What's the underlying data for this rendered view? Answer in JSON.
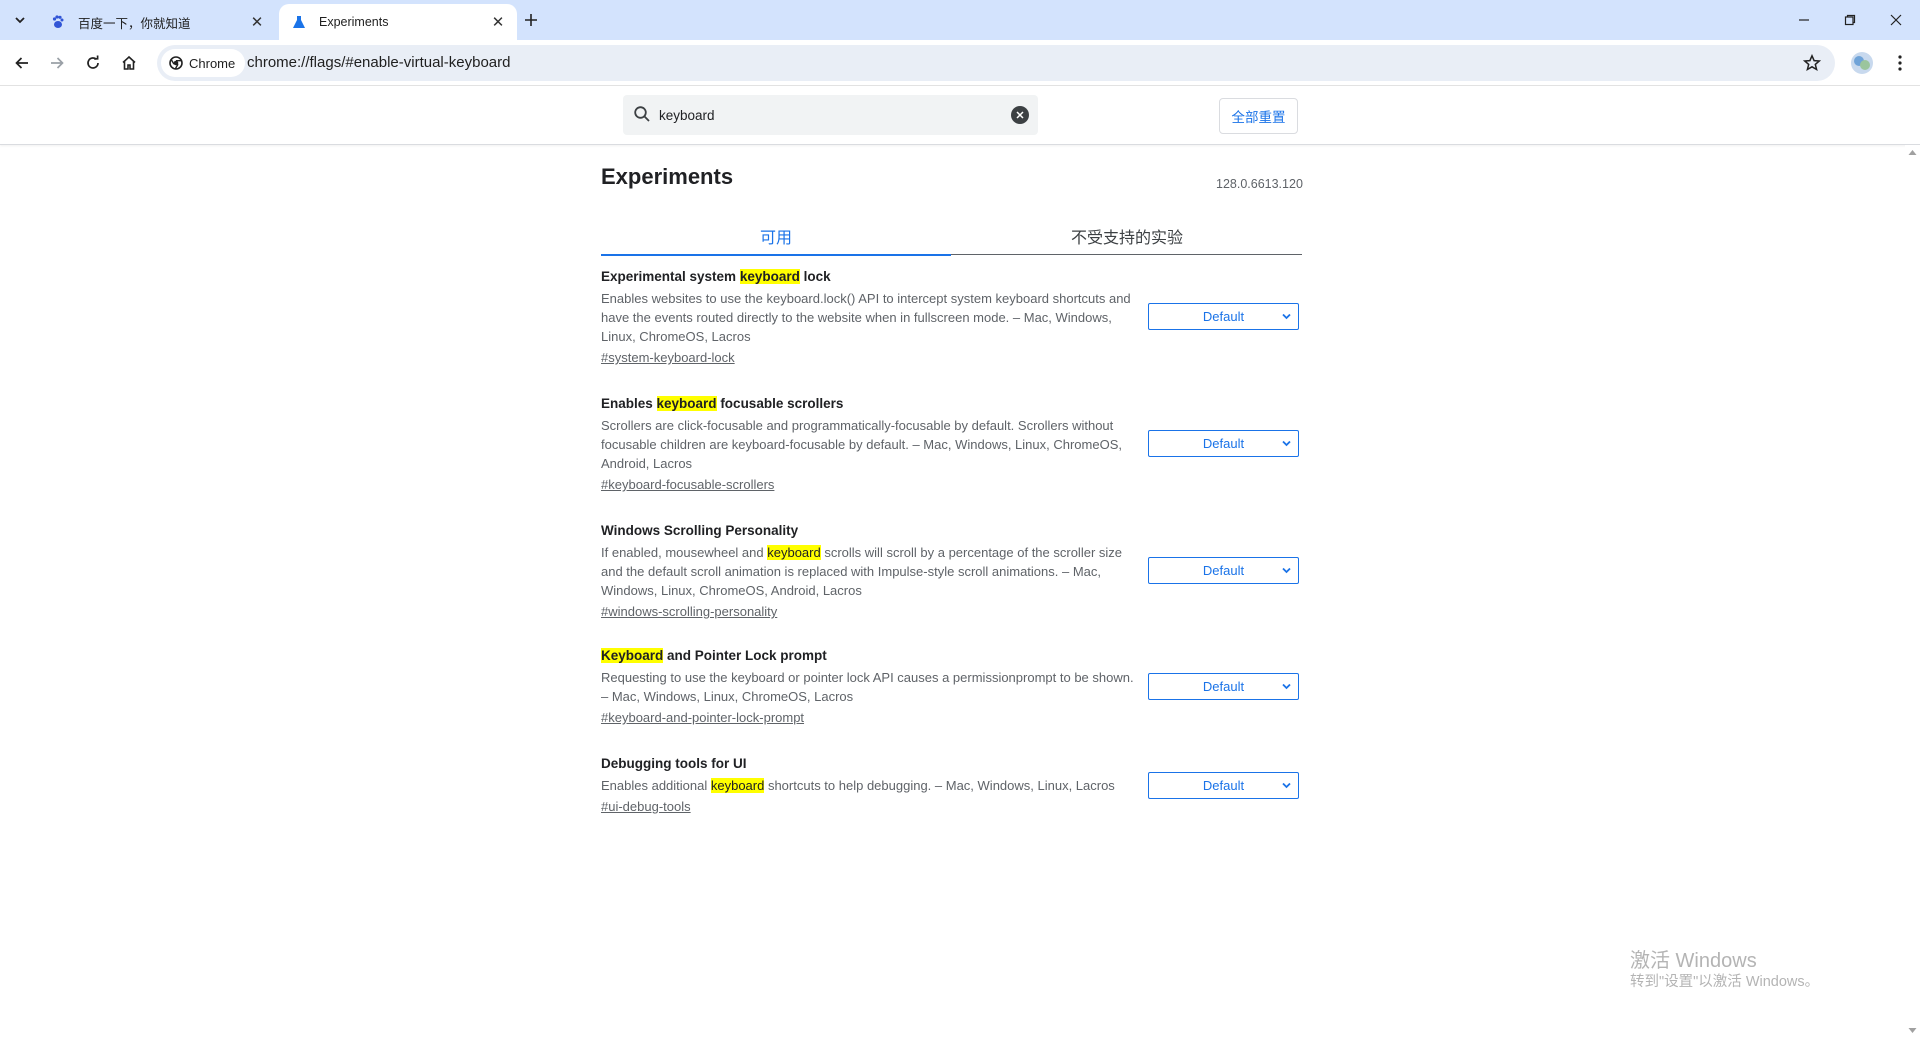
{
  "browser": {
    "tabs": [
      {
        "title": "百度一下，你就知道",
        "favicon": "baidu-paw-icon",
        "active": false
      },
      {
        "title": "Experiments",
        "favicon": "flask-icon",
        "active": true
      }
    ],
    "omnibox": {
      "chip_label": "Chrome",
      "url": "chrome://flags/#enable-virtual-keyboard"
    }
  },
  "flags_header": {
    "search_value": "keyboard",
    "reset_all_label": "全部重置"
  },
  "main": {
    "title": "Experiments",
    "version": "128.0.6613.120",
    "tabs": [
      {
        "label": "可用",
        "selected": true
      },
      {
        "label": "不受支持的实验",
        "selected": false
      }
    ]
  },
  "experiments": [
    {
      "name_pre": "Experimental system ",
      "name_hl": "keyboard",
      "name_post": " lock",
      "desc_pre": "Enables websites to use the keyboard.lock() API to intercept system keyboard shortcuts and have the events routed directly to the website when in fullscreen mode. – Mac, Windows, Linux, ChromeOS, Lacros",
      "desc_hl": "",
      "desc_post": "",
      "link": "#system-keyboard-lock",
      "value": "Default"
    },
    {
      "name_pre": "Enables ",
      "name_hl": "keyboard",
      "name_post": " focusable scrollers",
      "desc_pre": "Scrollers are click-focusable and programmatically-focusable by default. Scrollers without focusable children are keyboard-focusable by default. – Mac, Windows, Linux, ChromeOS, Android, Lacros",
      "desc_hl": "",
      "desc_post": "",
      "link": "#keyboard-focusable-scrollers",
      "value": "Default"
    },
    {
      "name_pre": "Windows Scrolling Personality",
      "name_hl": "",
      "name_post": "",
      "desc_pre": "If enabled, mousewheel and ",
      "desc_hl": "keyboard",
      "desc_post": " scrolls will scroll by a percentage of the scroller size and the default scroll animation is replaced with Impulse-style scroll animations. – Mac, Windows, Linux, ChromeOS, Android, Lacros",
      "link": "#windows-scrolling-personality",
      "value": "Default"
    },
    {
      "name_pre": "",
      "name_hl": "Keyboard",
      "name_post": " and Pointer Lock prompt",
      "desc_pre": "Requesting to use the keyboard or pointer lock API causes a permissionprompt to be shown. – Mac, Windows, Linux, ChromeOS, Lacros",
      "desc_hl": "",
      "desc_post": "",
      "link": "#keyboard-and-pointer-lock-prompt",
      "value": "Default"
    },
    {
      "name_pre": "Debugging tools for UI",
      "name_hl": "",
      "name_post": "",
      "desc_pre": "Enables additional ",
      "desc_hl": "keyboard",
      "desc_post": " shortcuts to help debugging. – Mac, Windows, Linux, Lacros",
      "link": "#ui-debug-tools",
      "value": "Default"
    }
  ],
  "watermark": {
    "line1": "激活 Windows",
    "line2": "转到\"设置\"以激活 Windows。"
  },
  "colors": {
    "tabstrip": "#d3e3fd",
    "accent": "#1a73e8",
    "highlight": "#ffff00"
  }
}
